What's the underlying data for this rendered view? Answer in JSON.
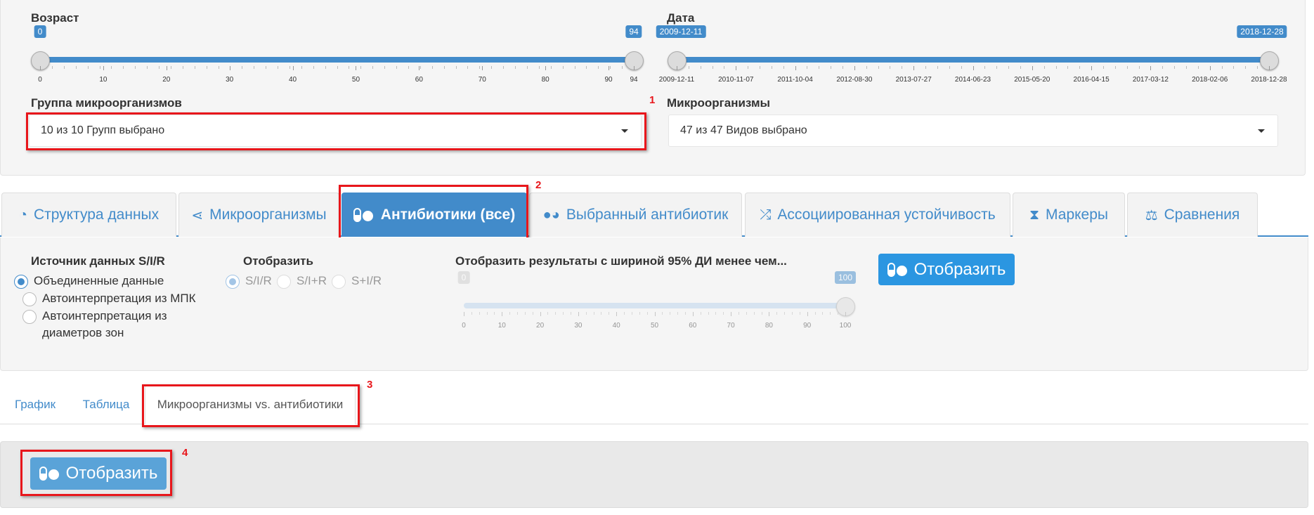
{
  "filters": {
    "age": {
      "label": "Возраст",
      "min_value": "0",
      "max_value": "94",
      "ticks": [
        "0",
        "10",
        "20",
        "30",
        "40",
        "50",
        "60",
        "70",
        "80",
        "90",
        "94"
      ]
    },
    "date": {
      "label": "Дата",
      "from_value": "2009-12-11",
      "to_value": "2018-12-28",
      "ticks": [
        "2009-12-11",
        "2010-11-07",
        "2011-10-04",
        "2012-08-30",
        "2013-07-27",
        "2014-06-23",
        "2015-05-20",
        "2016-04-15",
        "2017-03-12",
        "2018-02-06",
        "2018-12-28"
      ]
    },
    "microbe_group": {
      "label": "Группа микроорганизмов",
      "value": "10 из 10 Групп выбрано",
      "annotation": "1"
    },
    "microbes": {
      "label": "Микроорганизмы",
      "value": "47 из 47 Видов выбрано"
    }
  },
  "main_tabs": [
    {
      "label": "Структура данных",
      "icon": "pie-chart-icon"
    },
    {
      "label": "Микроорганизмы",
      "icon": "share-nodes-icon"
    },
    {
      "label": "Антибиотики (все)",
      "icon": "pills-icon"
    },
    {
      "label": "Выбранный антибиотик",
      "icon": "tablets-icon"
    },
    {
      "label": "Ассоциированная устойчивость",
      "icon": "random-icon"
    },
    {
      "label": "Маркеры",
      "icon": "dna-icon"
    },
    {
      "label": "Сравнения",
      "icon": "balance-scale-icon"
    }
  ],
  "main_tabs_annotation": "2",
  "options": {
    "source": {
      "label": "Источник данных S/I/R",
      "choices": [
        "Объединенные данные",
        "Автоинтерпретация из МПК",
        "Автоинтерпретация из",
        "диаметров зон"
      ],
      "selected": "Объединенные данные"
    },
    "display": {
      "label": "Отобразить",
      "choices": [
        "S/I/R",
        "S/I+R",
        "S+I/R"
      ],
      "selected": "S/I/R"
    },
    "ci_filter": {
      "label": "Отобразить результаты с шириной 95% ДИ менее чем...",
      "min_value": "0",
      "max_value": "100",
      "ticks": [
        "0",
        "10",
        "20",
        "30",
        "40",
        "50",
        "60",
        "70",
        "80",
        "90",
        "100"
      ]
    },
    "show_button": "Отобразить"
  },
  "sub_tabs": [
    "График",
    "Таблица",
    "Микроорганизмы vs. антибиотики"
  ],
  "sub_tabs_annotation": "3",
  "bottom": {
    "show_button": "Отобразить",
    "annotation": "4"
  },
  "colors": {
    "accent": "#428bca",
    "button": "#2b96e1",
    "annotation_red": "#e8161b"
  }
}
